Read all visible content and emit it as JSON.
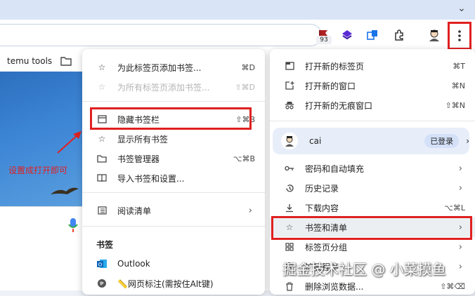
{
  "toolbar": {
    "extension_badge": "93"
  },
  "bookmarks_bar": {
    "items": [
      "temu tools",
      ""
    ]
  },
  "page": {
    "annotation": "设置成打开即可"
  },
  "bookmarks_submenu": {
    "items": [
      {
        "label": "为此标签页添加书签...",
        "shortcut": "⌘D",
        "icon": "star-icon",
        "disabled": false
      },
      {
        "label": "为所有标签页添加书签...",
        "shortcut": "⇧⌘D",
        "icon": "star-icon",
        "disabled": true
      },
      {
        "label": "隐藏书签栏",
        "shortcut": "⇧⌘B",
        "icon": "bookmark-bar-icon",
        "disabled": false
      },
      {
        "label": "显示所有书签",
        "shortcut": "",
        "icon": "star-icon",
        "disabled": false
      },
      {
        "label": "书签管理器",
        "shortcut": "⌥⌘B",
        "icon": "folder-icon",
        "disabled": false
      },
      {
        "label": "导入书签和设置...",
        "shortcut": "",
        "icon": "import-icon",
        "disabled": false
      },
      {
        "label": "阅读清单",
        "shortcut": "",
        "icon": "reading-list-icon",
        "disabled": false
      }
    ],
    "section_title": "书签",
    "bookmarks": [
      {
        "label": "Outlook",
        "icon": "outlook-icon"
      },
      {
        "label": "📏网页标注(需按住Alt键)",
        "icon": "globe-icon"
      }
    ]
  },
  "main_menu": {
    "items": [
      {
        "label": "打开新的标签页",
        "shortcut": "⌘T",
        "icon": "new-tab-icon"
      },
      {
        "label": "打开新的窗口",
        "shortcut": "⌘N",
        "icon": "new-window-icon"
      },
      {
        "label": "打开新的无痕窗口",
        "shortcut": "⇧⌘N",
        "icon": "incognito-icon"
      }
    ],
    "profile": {
      "name": "cai",
      "status": "已登录"
    },
    "items2": [
      {
        "label": "密码和自动填充",
        "icon": "key-icon"
      },
      {
        "label": "历史记录",
        "icon": "history-icon"
      },
      {
        "label": "下载内容",
        "shortcut": "⌥⌘L",
        "icon": "download-icon"
      },
      {
        "label": "书签和清单",
        "icon": "star-icon"
      },
      {
        "label": "标签页分组",
        "icon": "grid-icon"
      },
      {
        "label": "扩展程序",
        "icon": "puzzle-icon"
      },
      {
        "label": "删除浏览数据...",
        "shortcut": "⇧⌘⌫",
        "icon": "trash-icon"
      }
    ]
  },
  "watermark": "掘金技术社区 @ 小菜摸鱼",
  "colors": {
    "highlight": "#e02020",
    "profile_bg": "#e8eef9",
    "badge": "#d3e0f7"
  }
}
